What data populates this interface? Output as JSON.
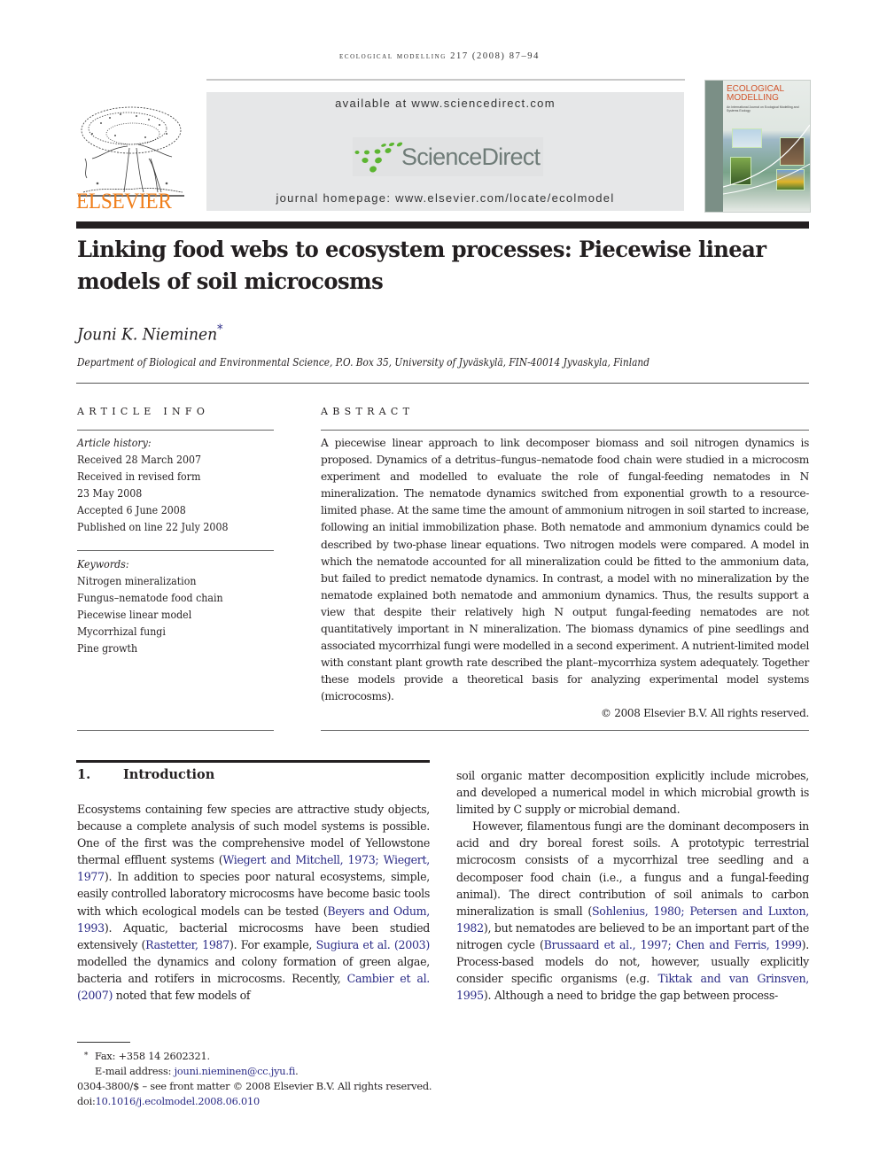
{
  "running_head": "ecological modelling 217 (2008) 87–94",
  "header": {
    "publisher_logo_text": "ELSEVIER",
    "available_at": "available at www.sciencedirect.com",
    "sciencedirect_logo_text": "ScienceDirect",
    "journal_homepage": "journal homepage: www.elsevier.com/locate/ecolmodel",
    "cover": {
      "title_line1": "ECOLOGICAL",
      "title_line2": "MODELLING",
      "subtitle": "An International Journal on Ecological Modelling and Systems Ecology"
    },
    "colors": {
      "elsevier_orange": "#f07e1a",
      "sciencedirect_green": "#5cb531",
      "sciencedirect_gray": "#6f7c78",
      "band_gray": "#e6e7e8",
      "link_blue": "#2a2a86"
    }
  },
  "article": {
    "title": "Linking food webs to ecosystem processes: Piecewise linear models of soil microcosms",
    "author": "Jouni K. Nieminen",
    "author_mark": "*",
    "affiliation": "Department of Biological and Environmental Science, P.O. Box 35, University of Jyväskylä, FIN-40014 Jyvaskyla, Finland"
  },
  "article_info": {
    "heading": "ARTICLE INFO",
    "history_label": "Article history:",
    "history": [
      "Received 28 March 2007",
      "Received in revised form",
      "23 May 2008",
      "Accepted 6 June 2008",
      "Published on line 22 July 2008"
    ],
    "keywords_label": "Keywords:",
    "keywords": [
      "Nitrogen mineralization",
      "Fungus–nematode food chain",
      "Piecewise linear model",
      "Mycorrhizal fungi",
      "Pine growth"
    ]
  },
  "abstract": {
    "heading": "ABSTRACT",
    "text": "A piecewise linear approach to link decomposer biomass and soil nitrogen dynamics is proposed. Dynamics of a detritus–fungus–nematode food chain were studied in a microcosm experiment and modelled to evaluate the role of fungal-feeding nematodes in N mineralization. The nematode dynamics switched from exponential growth to a resource-limited phase. At the same time the amount of ammonium nitrogen in soil started to increase, following an initial immobilization phase. Both nematode and ammonium dynamics could be described by two-phase linear equations. Two nitrogen models were compared. A model in which the nematode accounted for all mineralization could be fitted to the ammonium data, but failed to predict nematode dynamics. In contrast, a model with no mineralization by the nematode explained both nematode and ammonium dynamics. Thus, the results support a view that despite their relatively high N output fungal-feeding nematodes are not quantitatively important in N mineralization. The biomass dynamics of pine seedlings and associated mycorrhizal fungi were modelled in a second experiment. A nutrient-limited model with constant plant growth rate described the plant–mycorrhiza system adequately. Together these models provide a theoretical basis for analyzing experimental model systems (microcosms).",
    "copyright": "© 2008 Elsevier B.V. All rights reserved."
  },
  "introduction": {
    "number": "1.",
    "heading": "Introduction",
    "left_column": [
      {
        "t": "Ecosystems containing few species are attractive study objects, because a complete analysis of such model systems is possible. One of the first was the comprehensive model of Yellowstone thermal effluent systems ("
      },
      {
        "ref": "Wiegert and Mitchell, 1973; Wiegert, 1977"
      },
      {
        "t": "). In addition to species poor natural ecosystems, simple, easily controlled laboratory microcosms have become basic tools with which ecological models can be tested ("
      },
      {
        "ref": "Beyers and Odum, 1993"
      },
      {
        "t": "). Aquatic, bacterial microcosms have been studied extensively ("
      },
      {
        "ref": "Rastetter, 1987"
      },
      {
        "t": "). For example, "
      },
      {
        "ref": "Sugiura et al. (2003)"
      },
      {
        "t": " modelled the dynamics and colony formation of green algae, bacteria and rotifers in microcosms. Recently, "
      },
      {
        "ref": "Cambier et al. (2007)"
      },
      {
        "t": " noted that few models of"
      }
    ],
    "right_column_p1": "soil organic matter decomposition explicitly include microbes, and developed a numerical model in which microbial growth is limited by C supply or microbial demand.",
    "right_column_p2": [
      {
        "t": "However, filamentous fungi are the dominant decomposers in acid and dry boreal forest soils. A prototypic terrestrial microcosm consists of a mycorrhizal tree seedling and a decomposer food chain (i.e., a fungus and a fungal-feeding animal). The direct contribution of soil animals to carbon mineralization is small ("
      },
      {
        "ref": "Sohlenius, 1980; Petersen and Luxton, 1982"
      },
      {
        "t": "), but nematodes are believed to be an important part of the nitrogen cycle ("
      },
      {
        "ref": "Brussaard et al., 1997; Chen and Ferris, 1999"
      },
      {
        "t": "). Process-based models do not, however, usually explicitly consider specific organisms (e.g. "
      },
      {
        "ref": "Tiktak and van Grinsven, 1995"
      },
      {
        "t": "). Although a need to bridge the gap between process-"
      }
    ]
  },
  "footnotes": {
    "star": "*",
    "fax": "Fax: +358 14 2602321.",
    "email_label": "E-mail address: ",
    "email": "jouni.nieminen@cc.jyu.fi",
    "email_end": ".",
    "front_matter": "0304-3800/$ – see front matter © 2008 Elsevier B.V. All rights reserved.",
    "doi_label": "doi:",
    "doi": "10.1016/j.ecolmodel.2008.06.010"
  }
}
